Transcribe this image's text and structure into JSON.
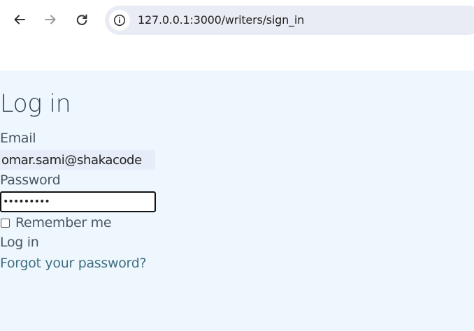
{
  "browser": {
    "url": "127.0.0.1:3000/writers/sign_in",
    "icons": {
      "back": "back-arrow-icon",
      "forward": "forward-arrow-icon",
      "reload": "reload-icon",
      "site_info": "info-icon"
    }
  },
  "page": {
    "title": "Log in",
    "email_label": "Email",
    "email_value": "omar.sami@shakacode",
    "password_label": "Password",
    "password_value": "•••••••••",
    "remember_label": "Remember me",
    "remember_checked": false,
    "submit_label": "Log in",
    "forgot_link": "Forgot your password?"
  },
  "colors": {
    "content_background": "#eff7fe",
    "link": "#3f6f80",
    "text": "#4a555d",
    "omnibox": "#e9ebf5"
  }
}
